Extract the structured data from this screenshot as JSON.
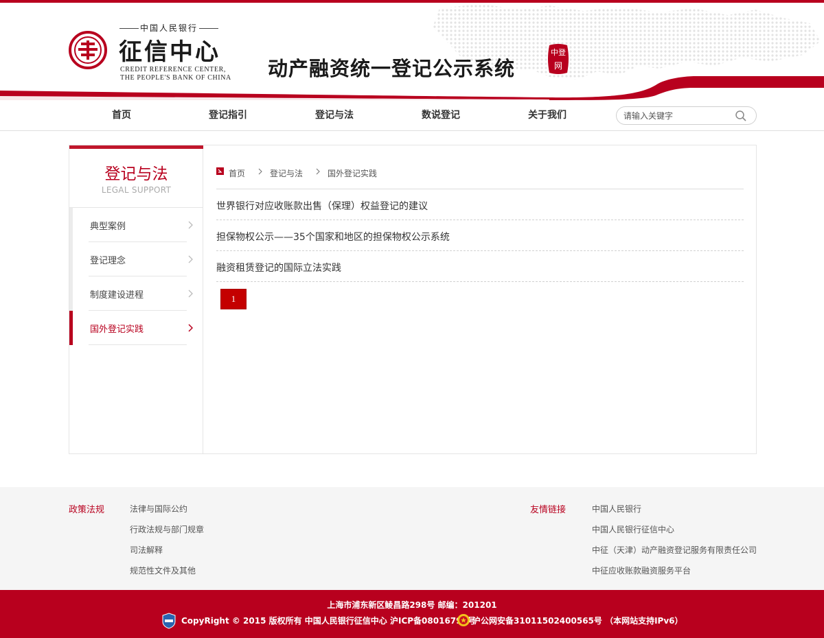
{
  "header": {
    "logo_top": "中国人民银行",
    "logo_main": "征信中心",
    "logo_en_line1": "CREDIT REFERENCE CENTER,",
    "logo_en_line2": "THE PEOPLE'S BANK OF CHINA",
    "site_title": "动产融资统一登记公示系统",
    "seal_text": "中登网",
    "brand_color": "#b8001e"
  },
  "nav": {
    "items": [
      {
        "label": "首页"
      },
      {
        "label": "登记指引"
      },
      {
        "label": "登记与法"
      },
      {
        "label": "数说登记"
      },
      {
        "label": "关于我们"
      }
    ],
    "search_placeholder": "请输入关键字",
    "search_icon": "search-icon"
  },
  "sidebar": {
    "title": "登记与法",
    "subtitle": "LEGAL SUPPORT",
    "items": [
      {
        "label": "典型案例",
        "active": false
      },
      {
        "label": "登记理念",
        "active": false
      },
      {
        "label": "制度建设进程",
        "active": false
      },
      {
        "label": "国外登记实践",
        "active": true
      }
    ]
  },
  "breadcrumb": {
    "items": [
      "首页",
      "登记与法",
      "国外登记实践"
    ]
  },
  "articles": [
    {
      "title": "世界银行对应收账款出售（保理）权益登记的建议"
    },
    {
      "title": "担保物权公示——35个国家和地区的担保物权公示系统"
    },
    {
      "title": "融资租赁登记的国际立法实践"
    }
  ],
  "pagination": {
    "current_page": "1"
  },
  "footer_links": {
    "policy_heading": "政策法规",
    "policy_links": [
      "法律与国际公约",
      "行政法规与部门规章",
      "司法解释",
      "规范性文件及其他"
    ],
    "friend_heading": "友情链接",
    "friend_links": [
      "中国人民银行",
      "中国人民银行征信中心",
      "中征（天津）动产融资登记服务有限责任公司",
      "中征应收账款融资服务平台"
    ]
  },
  "footer": {
    "address": "上海市浦东新区鲮昌路298号 邮编：201201",
    "copyright": "CopyRight © 2015 版权所有 中国人民银行征信中心 沪ICP备08016794号",
    "police_record": "沪公网安备31011502400565号 （本网站支持IPv6）"
  }
}
